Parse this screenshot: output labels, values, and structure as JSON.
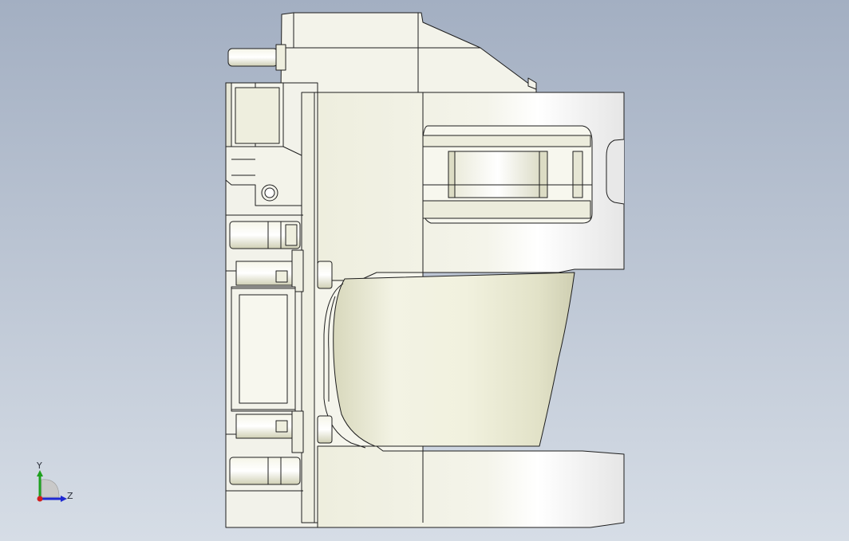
{
  "viewport": {
    "background_top": "#a3afc2",
    "background_bottom": "#d6dde6"
  },
  "model": {
    "description_icon": "cad-part-side-view",
    "body_fill": "#f2f2ea",
    "highlight_fill": "#ffffff",
    "shade_fill": "#d9d9c4",
    "edge_color": "#1e1e1e"
  },
  "triad": {
    "y_label": "Y",
    "z_label": "Z",
    "y_color": "#1ea01e",
    "z_color": "#1e28d2",
    "x_color": "#d21e1e"
  }
}
